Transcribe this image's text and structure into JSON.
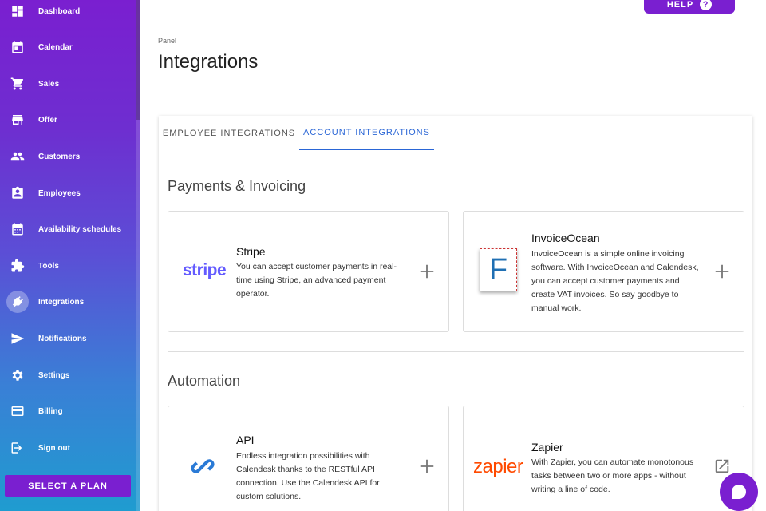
{
  "sidebar": {
    "items": [
      {
        "label": "Dashboard",
        "icon": "dashboard-icon"
      },
      {
        "label": "Calendar",
        "icon": "calendar-icon"
      },
      {
        "label": "Sales",
        "icon": "cart-icon"
      },
      {
        "label": "Offer",
        "icon": "store-icon"
      },
      {
        "label": "Customers",
        "icon": "people-icon"
      },
      {
        "label": "Employees",
        "icon": "badge-icon"
      },
      {
        "label": "Availability schedules",
        "icon": "schedule-icon"
      },
      {
        "label": "Tools",
        "icon": "puzzle-icon"
      },
      {
        "label": "Integrations",
        "icon": "plug-icon",
        "active": true
      },
      {
        "label": "Notifications",
        "icon": "send-icon"
      },
      {
        "label": "Settings",
        "icon": "gear-icon"
      },
      {
        "label": "Billing",
        "icon": "credit-card-icon"
      },
      {
        "label": "Sign out",
        "icon": "sign-out-icon"
      }
    ],
    "plan_button": "SELECT A PLAN"
  },
  "header": {
    "help_label": "HELP",
    "help_icon_glyph": "?",
    "breadcrumb": "Panel",
    "title": "Integrations"
  },
  "tabs": [
    {
      "label": "EMPLOYEE INTEGRATIONS",
      "active": false
    },
    {
      "label": "ACCOUNT INTEGRATIONS",
      "active": true
    }
  ],
  "sections": {
    "payments": {
      "title": "Payments & Invoicing",
      "cards": [
        {
          "name": "Stripe",
          "logo_text": "stripe",
          "description": "You can accept customer payments in real-time using Stripe, an advanced payment operator.",
          "action": "add-icon"
        },
        {
          "name": "InvoiceOcean",
          "logo_text": "F",
          "description": "InvoiceOcean is a simple online invoicing software. With InvoiceOcean and Calendesk, you can accept customer payments and create VAT invoices. So say goodbye to manual work.",
          "action": "add-icon"
        }
      ]
    },
    "automation": {
      "title": "Automation",
      "cards": [
        {
          "name": "API",
          "logo_text": "",
          "description": "Endless integration possibilities with Calendesk thanks to the RESTful API connection. Use the Calendesk API for custom solutions.",
          "action": "add-icon"
        },
        {
          "name": "Zapier",
          "logo_text": "zapier",
          "description": "With Zapier, you can automate monotonous tasks between two or more apps - without writing a line of code.",
          "action": "open-external-icon"
        }
      ]
    }
  },
  "colors": {
    "accent": "#7a1fd0",
    "tab_active": "#2a66d6",
    "stripe": "#635bff",
    "zapier": "#ff4a00",
    "invoiceocean": "#1f6fb3",
    "api_link": "#2a7ad6"
  }
}
